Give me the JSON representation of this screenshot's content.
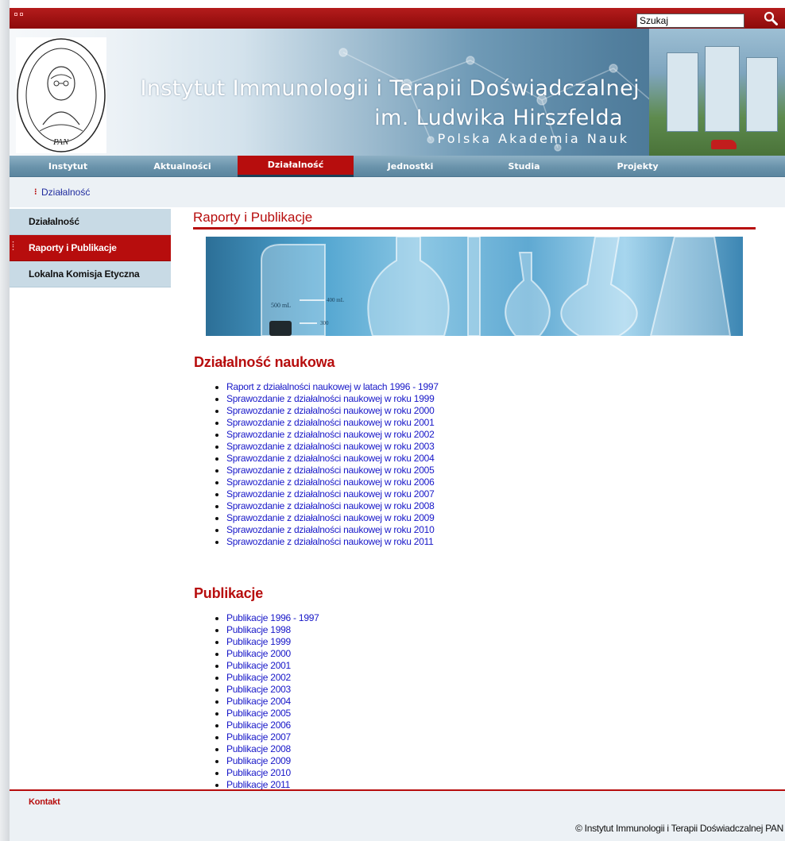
{
  "header": {
    "title_line1": "Instytut Immunologii i Terapii Doświadczalnej",
    "title_line2": "im. Ludwika Hirszfelda",
    "title_line3": "Polska Akademia Nauk",
    "logo_text": "Instytut Immunologii i Terapii Doświadczalnej",
    "logo_sub": "PAN"
  },
  "search": {
    "value": "Szukaj"
  },
  "nav": {
    "items": [
      {
        "label": "Instytut"
      },
      {
        "label": "Aktualności"
      },
      {
        "label": "Działalność"
      },
      {
        "label": "Jednostki"
      },
      {
        "label": "Studia"
      },
      {
        "label": "Projekty"
      }
    ],
    "active_index": 2
  },
  "breadcrumb": {
    "marker": "⁝",
    "item": "Działalność"
  },
  "sidebar": {
    "items": [
      {
        "label": "Działalność"
      },
      {
        "label": "Raporty i Publikacje"
      },
      {
        "label": "Lokalna Komisja Etyczna"
      }
    ],
    "active_index": 1
  },
  "content": {
    "page_title": "Raporty i Publikacje",
    "banner_labels": {
      "volume": "500 mL",
      "mark1": "400 mL",
      "mark2": "300"
    },
    "section1": {
      "heading": "Działalność naukowa",
      "links": [
        "Raport z działalności naukowej w latach 1996 - 1997",
        "Sprawozdanie z działalności naukowej w roku 1999",
        "Sprawozdanie z działalności naukowej w roku 2000",
        "Sprawozdanie z działalności naukowej w roku 2001",
        "Sprawozdanie z działalności naukowej w roku 2002",
        "Sprawozdanie z działalności naukowej w roku 2003",
        "Sprawozdanie z działalności naukowej w roku 2004",
        "Sprawozdanie z działalności naukowej w roku 2005",
        "Sprawozdanie z działalności naukowej w roku 2006",
        "Sprawozdanie z działalności naukowej w roku 2007",
        "Sprawozdanie z działalności naukowej w roku 2008",
        "Sprawozdanie z działalności naukowej w roku 2009",
        "Sprawozdanie z działalności naukowej w roku 2010",
        "Sprawozdanie z działalności naukowej w roku 2011"
      ]
    },
    "section2": {
      "heading": "Publikacje",
      "links": [
        "Publikacje 1996 - 1997",
        "Publikacje 1998",
        "Publikacje 1999",
        "Publikacje 2000",
        "Publikacje 2001",
        "Publikacje 2002",
        "Publikacje 2003",
        "Publikacje 2004",
        "Publikacje 2005",
        "Publikacje 2006",
        "Publikacje 2007",
        "Publikacje 2008",
        "Publikacje 2009",
        "Publikacje 2010",
        "Publikacje 2011"
      ]
    }
  },
  "footer": {
    "contact_link": "Kontakt",
    "copyright": "© Instytut Immunologii i Terapii Doświadczalnej PAN"
  },
  "icons": {
    "search_button": "magnifier-icon",
    "breadcrumb_marker": "dots-bullet-icon",
    "window_controls": "window-controls-icon"
  },
  "colors": {
    "brand_red": "#b70d0d",
    "nav_blue": "#6a93ab",
    "sidebar_blue": "#c8dae5",
    "link_blue": "#1717c8",
    "background_light": "#ecf1f5"
  }
}
